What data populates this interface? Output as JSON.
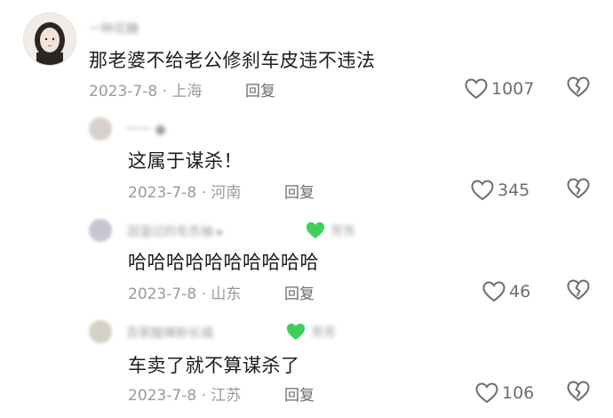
{
  "comments": [
    {
      "author": "一种花糖",
      "text": "那老婆不给老公修刹车皮违不违法",
      "date": "2023-7-8",
      "location": "上海",
      "reply_label": "回复",
      "likes": "1007"
    },
    {
      "author": "一一 ●",
      "text": "这属于谋杀！",
      "date": "2023-7-8",
      "location": "河南",
      "reply_label": "回复",
      "likes": "345"
    },
    {
      "author": "泪湿过的毛衣袖  ▸",
      "author_suffix": "芳芳",
      "text": "哈哈哈哈哈哈哈哈哈哈",
      "date": "2023-7-8",
      "location": "山东",
      "reply_label": "回复",
      "likes": "46"
    },
    {
      "author": "百家酸辣粉长城",
      "author_suffix": "芳芳",
      "text": "车卖了就不算谋杀了",
      "date": "2023-7-8",
      "location": "江苏",
      "reply_label": "回复",
      "likes": "106"
    }
  ],
  "icons": {
    "like": "heart-outline-icon",
    "dislike": "broken-heart-icon",
    "badge": "green-heart-emoji"
  },
  "colors": {
    "text": "#1c1c1c",
    "meta": "#9a9a9a",
    "icon": "#6e6e6e",
    "green_heart": "#3fcf5a"
  }
}
